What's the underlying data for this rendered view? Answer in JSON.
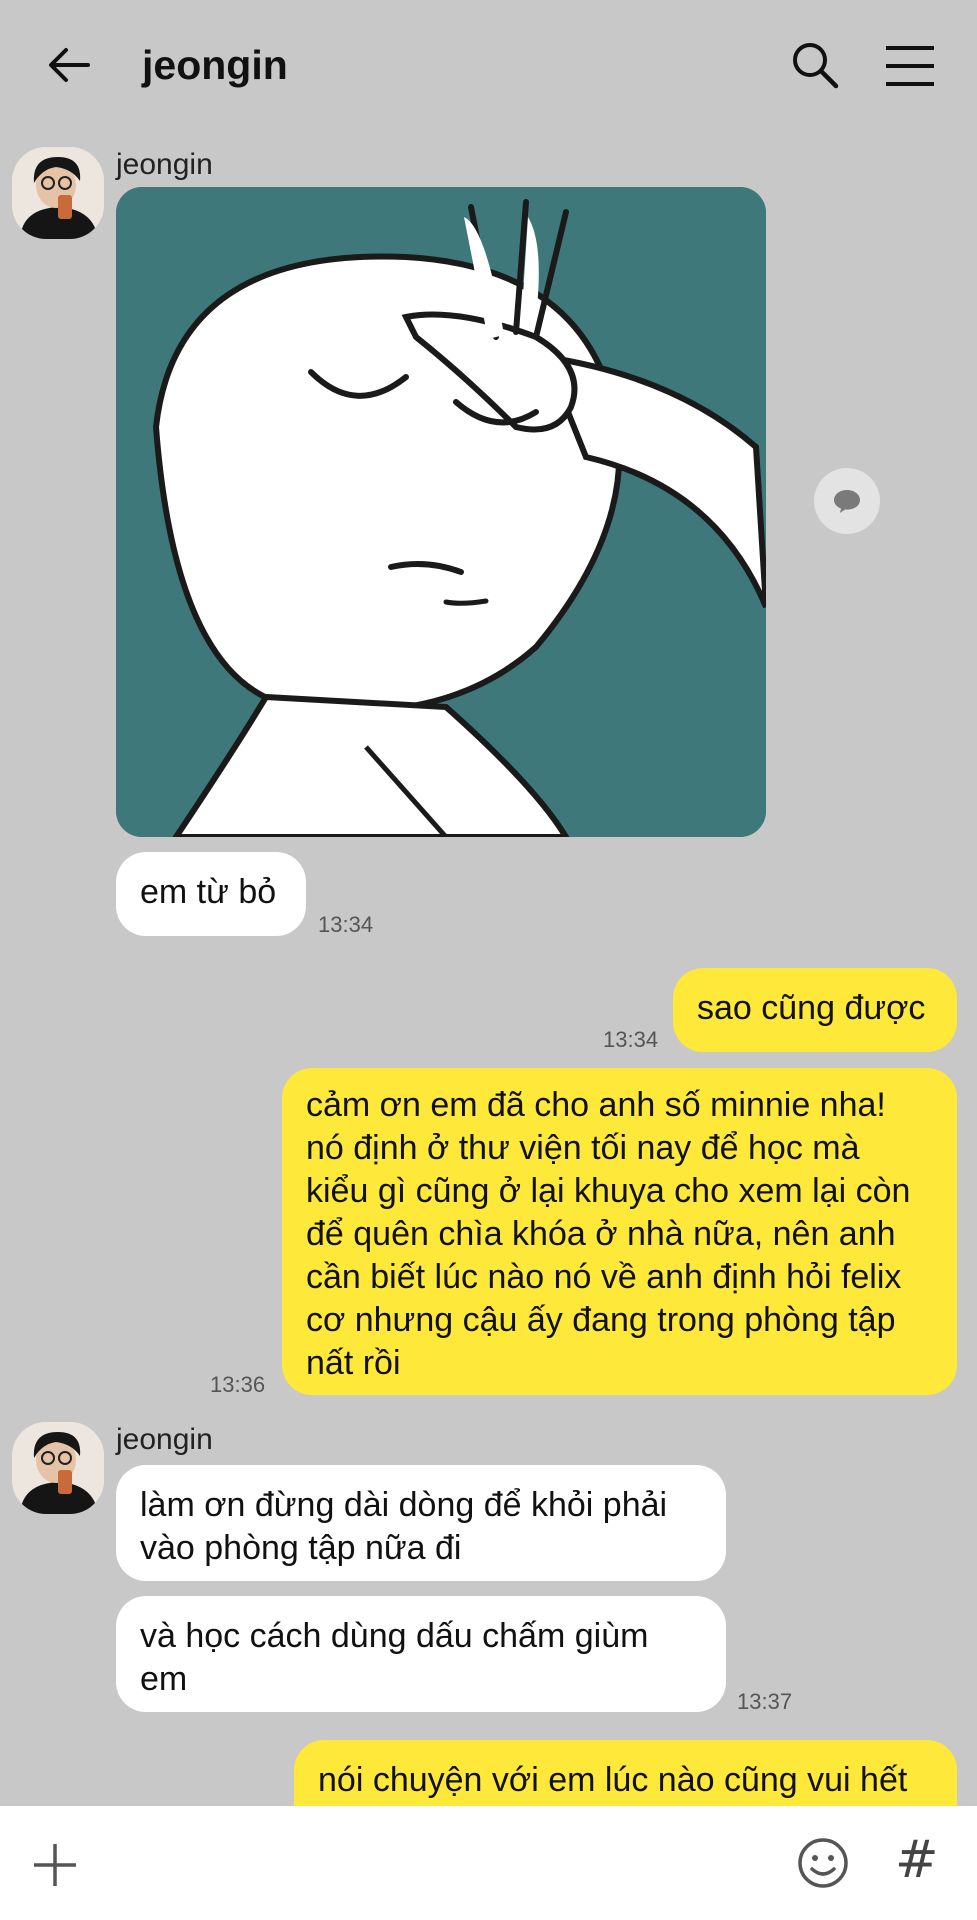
{
  "header": {
    "title": "jeongin",
    "back_icon": "arrow-left-icon",
    "search_icon": "search-icon",
    "menu_icon": "hamburger-menu-icon"
  },
  "colors": {
    "background": "#c8c8c8",
    "incoming_bubble": "#ffffff",
    "outgoing_bubble": "#fee83a",
    "image_teal": "#3f787a"
  },
  "messages": {
    "group1": {
      "sender": "jeongin",
      "bubble1": "em từ bỏ",
      "time": "13:34"
    },
    "out1": {
      "text": "sao cũng được",
      "time": "13:34"
    },
    "out2": {
      "text": "cảm ơn em đã cho anh số minnie nha!\nnó định ở thư viện tối nay để học mà\nkiểu gì cũng ở lại khuya cho xem lại còn\nđể quên chìa khóa ở nhà nữa, nên anh\ncần biết lúc nào nó về anh định hỏi felix\ncơ nhưng cậu ấy đang trong phòng tập\nnất rồi",
      "time": "13:36"
    },
    "group2": {
      "sender": "jeongin",
      "bubble1": "làm ơn đừng dài dòng để khỏi phải\nvào phòng tập nữa đi",
      "bubble2": "và học cách dùng dấu chấm giùm\nem",
      "time": "13:37"
    },
    "out3": {
      "text": "nói chuyện với em lúc nào cũng vui hết"
    }
  },
  "input_bar": {
    "plus_icon": "plus-icon",
    "emoji_icon": "emoji-icon",
    "hash_label": "#"
  }
}
